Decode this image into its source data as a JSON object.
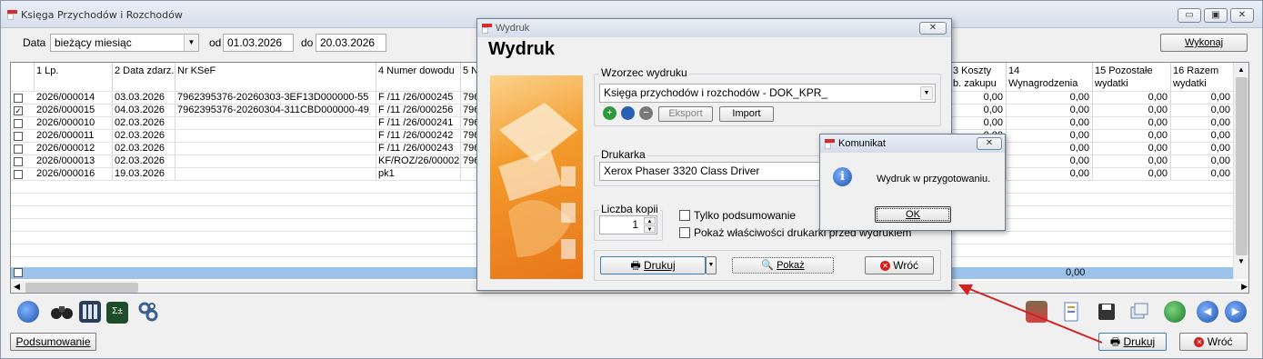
{
  "main_window": {
    "title": "Księga Przychodów i Rozchodów",
    "minimize": "▭",
    "maximize": "▣",
    "close": "✕"
  },
  "filter": {
    "data_label": "Data",
    "period_value": "bieżący miesiąc",
    "from_label": "od",
    "from_value": "01.03.2026",
    "to_label": "do",
    "to_value": "20.03.2026",
    "execute_button": "Wykonaj"
  },
  "table": {
    "headers": {
      "lp": "1 Lp.",
      "date": "2 Data zdarz.",
      "ksef": "Nr KSeF",
      "doc": "4 Numer dowodu",
      "col5": "5 N",
      "col13a": "3 Koszty",
      "col13b": "b. zakupu",
      "col14a": "14",
      "col14b": "Wynagrodzenia",
      "col15a": "15 Pozostałe",
      "col15b": "wydatki",
      "col16a": "16 Razem",
      "col16b": "wydatki"
    },
    "rows": [
      {
        "checked": "",
        "lp": "2026/000014",
        "date": "03.03.2026",
        "ksef": "7962395376-20260303-3EF13D000000-55",
        "doc": "F /11 /26/000245",
        "col5": "796",
        "c13": "0,00",
        "c14": "0,00",
        "c15": "0,00",
        "c16": "0,00"
      },
      {
        "checked": "✓",
        "lp": "2026/000015",
        "date": "04.03.2026",
        "ksef": "7962395376-20260304-311CBD000000-49",
        "doc": "F /11 /26/000256",
        "col5": "796",
        "c13": "0,00",
        "c14": "0,00",
        "c15": "0,00",
        "c16": "0,00"
      },
      {
        "checked": "",
        "lp": "2026/000010",
        "date": "02.03.2026",
        "ksef": "",
        "doc": "F /11 /26/000241",
        "col5": "796",
        "c13": "0,00",
        "c14": "0,00",
        "c15": "0,00",
        "c16": "0,00"
      },
      {
        "checked": "",
        "lp": "2026/000011",
        "date": "02.03.2026",
        "ksef": "",
        "doc": "F /11 /26/000242",
        "col5": "796",
        "c13": "0,00",
        "c14": "0,00",
        "c15": "0,00",
        "c16": "0,00"
      },
      {
        "checked": "",
        "lp": "2026/000012",
        "date": "02.03.2026",
        "ksef": "",
        "doc": "F /11 /26/000243",
        "col5": "796",
        "c13": "0,00",
        "c14": "0,00",
        "c15": "0,00",
        "c16": "0,00"
      },
      {
        "checked": "",
        "lp": "2026/000013",
        "date": "02.03.2026",
        "ksef": "",
        "doc": "KF/ROZ/26/00002",
        "col5": "796",
        "c13": "0,00",
        "c14": "0,00",
        "c15": "0,00",
        "c16": "0,00"
      },
      {
        "checked": "",
        "lp": "2026/000016",
        "date": "19.03.2026",
        "ksef": "",
        "doc": "pk1",
        "col5": "",
        "c13": "0,00",
        "c14": "0,00",
        "c15": "0,00",
        "c16": "0,00"
      }
    ],
    "sum_value": "0,00"
  },
  "bottom": {
    "summary_button": "Podsumowanie",
    "print_button": "Drukuj",
    "back_button": "Wróć"
  },
  "print_dialog": {
    "title": "Wydruk",
    "heading": "Wydruk",
    "template_group": "Wzorzec wydruku",
    "template_value": "Księga przychodów i rozchodów - DOK_KPR_",
    "export_button": "Eksport",
    "import_button": "Import",
    "printer_group": "Drukarka",
    "printer_value": "Xerox Phaser 3320 Class Driver",
    "copies_group": "Liczba kopii",
    "copies_value": "1",
    "only_summary_label": "Tylko podsumowanie",
    "show_props_label": "Pokaż właściwości drukarki przed wydrukiem",
    "print_button": "Drukuj",
    "preview_button": "Pokaż",
    "back_button": "Wróć"
  },
  "message_box": {
    "title": "Komunikat",
    "message": "Wydruk w przygotowaniu.",
    "ok_button": "OK"
  },
  "colors": {
    "selection_row": "#9dc3ea",
    "arrow": "#d42020",
    "art_orange": "#f39a2b"
  }
}
